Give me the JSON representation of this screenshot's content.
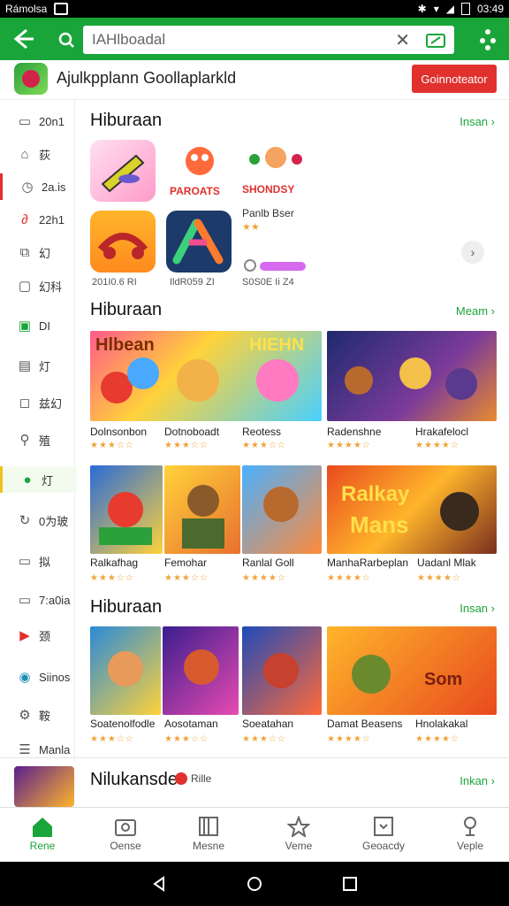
{
  "status_bar": {
    "carrier": "Rámolsa",
    "time": "03:49"
  },
  "search": {
    "value": "IAHlboadal"
  },
  "banner": {
    "title": "Ajulkpplann Goollaplarkld",
    "button": "Goinnoteator"
  },
  "sidebar": {
    "items": [
      {
        "label": "20n1",
        "icon": "square-icon"
      },
      {
        "label": "荻",
        "icon": "home-icon"
      },
      {
        "label": "2a.is",
        "icon": "clock-icon"
      },
      {
        "label": "22h1",
        "icon": "link-icon"
      },
      {
        "label": "幻",
        "icon": "external-icon"
      },
      {
        "label": "幻科",
        "icon": "frame-icon"
      },
      {
        "label": "DI",
        "icon": "grid-icon"
      },
      {
        "label": "灯",
        "icon": "list-icon"
      },
      {
        "label": "兹幻",
        "icon": "chat-icon"
      },
      {
        "label": "殖",
        "icon": "search-icon"
      },
      {
        "label": "灯",
        "icon": "whatsapp-icon"
      },
      {
        "label": "0为玻",
        "icon": "refresh-icon"
      },
      {
        "label": "拟",
        "icon": "media-icon"
      },
      {
        "label": "7:a0ia",
        "icon": "screen-icon"
      },
      {
        "label": "颈",
        "icon": "youtube-icon"
      },
      {
        "label": "Siinos",
        "icon": "compass-icon"
      },
      {
        "label": "鞍",
        "icon": "settings-icon"
      },
      {
        "label": "Manla",
        "icon": "menu-icon"
      }
    ]
  },
  "sections": [
    {
      "title": "Hiburaan",
      "link": "Insan"
    },
    {
      "title": "Hiburaan",
      "link": "Meam"
    },
    {
      "title": "Hiburaan",
      "link": "Insan"
    },
    {
      "title": "Nilukansde",
      "link": "Inkan",
      "badge": "Rille"
    }
  ],
  "section1": {
    "text1": "Panlb Bser",
    "dates": [
      "201I0.6 RI",
      "IldR059 ZI",
      "S0S0E Ii Z4"
    ]
  },
  "section2": {
    "cards": [
      {
        "name": "Dolnsonbon"
      },
      {
        "name": "Dotnoboadt"
      },
      {
        "name": "Reotess"
      },
      {
        "name": "Radenshne"
      },
      {
        "name": "Hrakafelocl"
      }
    ]
  },
  "section3": {
    "cards": [
      {
        "name": "Ralkafhag"
      },
      {
        "name": "Femohar"
      },
      {
        "name": "Ranlal Goll"
      },
      {
        "name": "ManhaRarbeplan"
      },
      {
        "name": "Uadanl Mlak"
      }
    ]
  },
  "section4": {
    "cards": [
      {
        "name": "Soatenolfodle"
      },
      {
        "name": "Aosotaman"
      },
      {
        "name": "Soeatahan"
      },
      {
        "name": "Damat Beasens"
      },
      {
        "name": "Hnolakakal"
      }
    ]
  },
  "bottom_nav": [
    {
      "label": "Rene"
    },
    {
      "label": "Oense"
    },
    {
      "label": "Mesne"
    },
    {
      "label": "Veme"
    },
    {
      "label": "Geoacdy"
    },
    {
      "label": "Veple"
    }
  ],
  "colors": {
    "brand": "#1aa53a",
    "accent": "#e0312e"
  }
}
